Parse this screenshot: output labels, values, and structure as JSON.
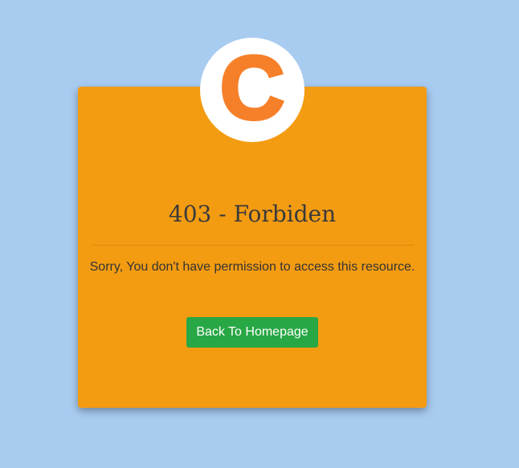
{
  "logo": {
    "letter": "C",
    "circle_color": "#ffffff",
    "letter_color": "#f6802a"
  },
  "error": {
    "title": "403 - Forbiden",
    "message": "Sorry, You don't have permission to access this resource."
  },
  "actions": {
    "home_button_label": "Back To Homepage"
  },
  "colors": {
    "page_background": "#a8cbf0",
    "card_background": "#f39c12",
    "button_background": "#28a745",
    "text": "#333333"
  }
}
